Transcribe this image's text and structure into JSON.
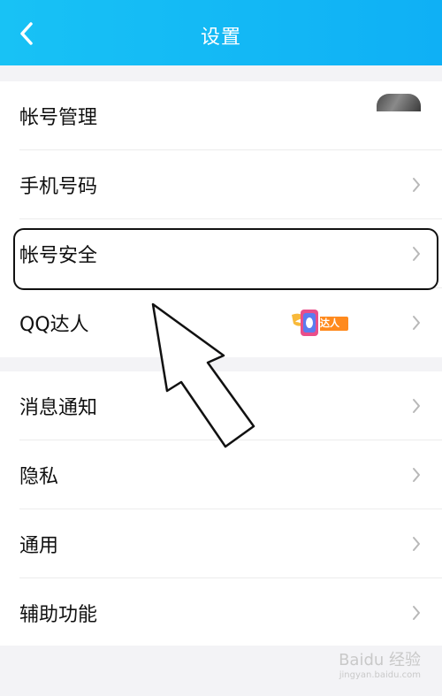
{
  "header": {
    "title": "设置"
  },
  "group1": {
    "items": [
      {
        "label": "帐号管理"
      },
      {
        "label": "手机号码"
      },
      {
        "label": "帐号安全"
      },
      {
        "label": "QQ达人",
        "badge_text": "达人"
      }
    ]
  },
  "group2": {
    "items": [
      {
        "label": "消息通知"
      },
      {
        "label": "隐私"
      },
      {
        "label": "通用"
      },
      {
        "label": "辅助功能"
      }
    ]
  },
  "watermark": {
    "brand": "Baidu 经验",
    "url": "jingyan.baidu.com"
  },
  "colors": {
    "header": "#12b8f5",
    "row_bg": "#ffffff",
    "page_bg": "#f3f3f6",
    "chevron": "#b8b8b8"
  },
  "icons": {
    "back": "chevron-left-icon",
    "row_arrow": "chevron-right-icon",
    "badge": "winged-qq-badge-icon"
  }
}
